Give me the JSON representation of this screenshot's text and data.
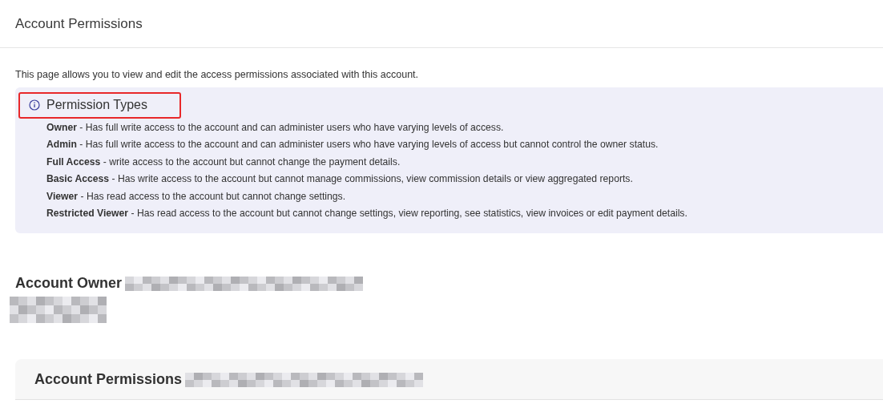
{
  "page_title": "Account Permissions",
  "intro": "This page allows you to view and edit the access permissions associated with this account.",
  "info_panel": {
    "title": "Permission Types",
    "highlighted": true,
    "items": [
      "**Owner** - Has full write access to the account and can administer users who have varying levels of access.",
      "**Admin** - Has full write access to the account and can administer users who have varying levels of access but cannot control the owner status.",
      "**Full Access** - write access to the account but cannot change the payment details.",
      "**Basic Access** - Has write access to the account but cannot manage commissions, view commission details or view aggregated reports.",
      "**Viewer** - Has read access to the account but cannot change settings.",
      "**Restricted Viewer** - Has read access to the account but cannot change settings, view reporting, see statistics, view invoices or edit payment details."
    ]
  },
  "account_owner": {
    "label": "Account Owner"
  },
  "permissions_card": {
    "title": "Account Permissions"
  }
}
